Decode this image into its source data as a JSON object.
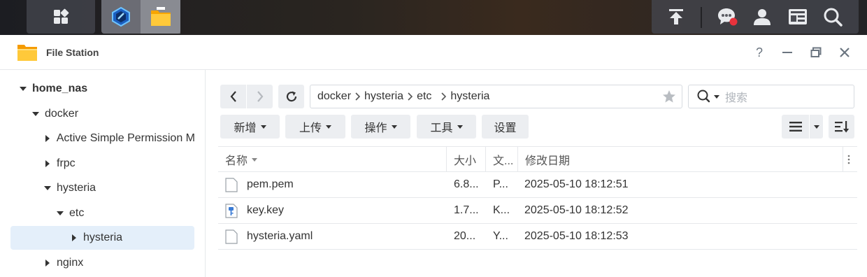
{
  "window": {
    "title": "File Station"
  },
  "sidebar": {
    "items": [
      {
        "label": "home_nas"
      },
      {
        "label": "docker"
      },
      {
        "label": "Active Simple Permission M"
      },
      {
        "label": "frpc"
      },
      {
        "label": "hysteria"
      },
      {
        "label": "etc"
      },
      {
        "label": "hysteria"
      },
      {
        "label": "nginx"
      }
    ]
  },
  "path": {
    "segments": [
      "docker",
      "hysteria",
      "etc",
      "hysteria"
    ]
  },
  "search": {
    "placeholder": "搜索"
  },
  "toolbar": {
    "create": "新增",
    "upload": "上传",
    "action": "操作",
    "tools": "工具",
    "settings": "设置"
  },
  "table": {
    "headers": {
      "name": "名称",
      "size": "大小",
      "type": "文...",
      "modified": "修改日期"
    },
    "rows": [
      {
        "name": "pem.pem",
        "size": "6.8...",
        "type": "P...",
        "modified": "2025-05-10 18:12:51",
        "icon": "file-icon"
      },
      {
        "name": "key.key",
        "size": "1.7...",
        "type": "K...",
        "modified": "2025-05-10 18:12:52",
        "icon": "key-file-icon"
      },
      {
        "name": "hysteria.yaml",
        "size": "20...",
        "type": "Y...",
        "modified": "2025-05-10 18:12:53",
        "icon": "file-icon"
      }
    ]
  },
  "colors": {
    "accent": "#e4effa",
    "button": "#eceef1",
    "notification": "#e8323c"
  }
}
